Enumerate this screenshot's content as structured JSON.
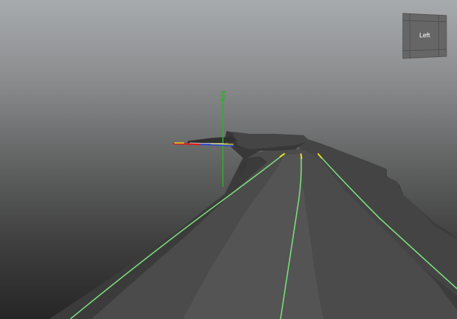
{
  "viewport": {
    "name": "3d-viewport",
    "background_top": "#a8abae",
    "background_bottom": "#262626"
  },
  "view_cube": {
    "face_label": "Left",
    "face_color": "#666666",
    "grid_color": "#4e4e4e"
  },
  "colors": {
    "mesh_main": "#4a4a4a",
    "mesh_dark": "#363636",
    "mesh_side": "#3e3e3e",
    "curve_highlight": "#7de07d",
    "curve_tip": "#e8e020",
    "manipulator_y": "#2fae2f",
    "manipulator_x": "#d42020",
    "manipulator_z": "#3050d0"
  }
}
